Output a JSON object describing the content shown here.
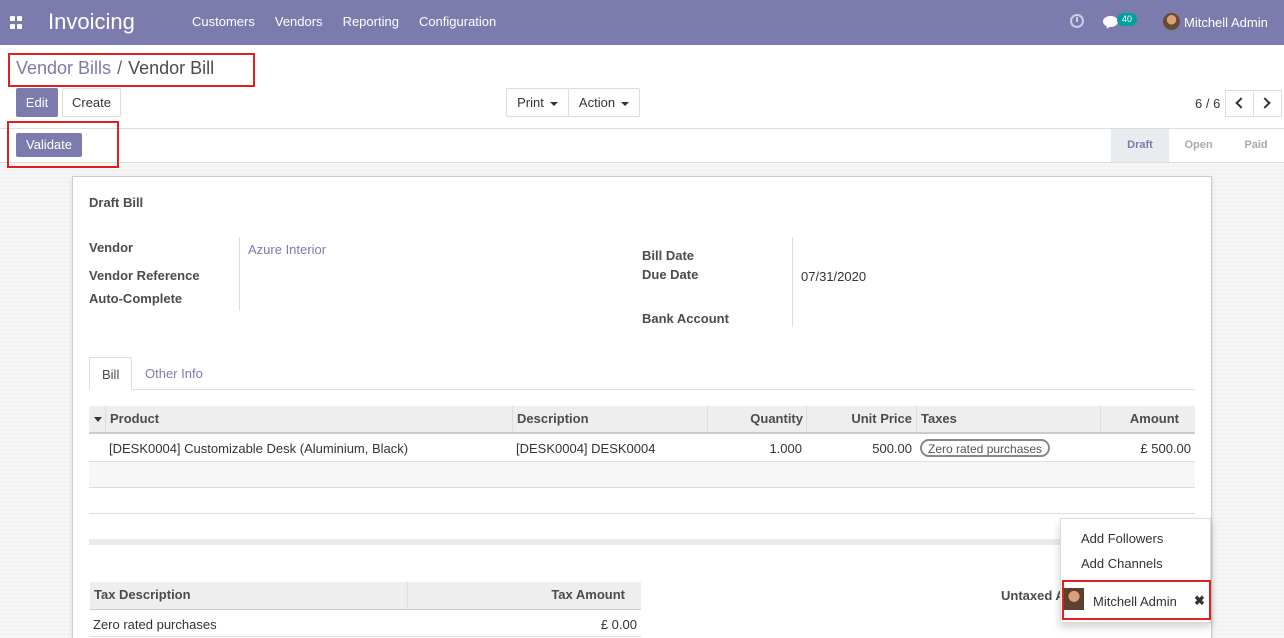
{
  "navbar": {
    "app_title": "Invoicing",
    "menu": [
      "Customers",
      "Vendors",
      "Reporting",
      "Configuration"
    ],
    "messages_count": "40",
    "user_name": "Mitchell Admin",
    "accent_color": "#7c7bad"
  },
  "breadcrumb": {
    "parent": "Vendor Bills",
    "separator": "/",
    "current": "Vendor Bill"
  },
  "buttons": {
    "edit": "Edit",
    "create": "Create",
    "print": "Print",
    "action": "Action",
    "validate": "Validate"
  },
  "pager": {
    "value": "6 / 6"
  },
  "statusbar": {
    "stages": [
      "Draft",
      "Open",
      "Paid"
    ],
    "active": "Draft"
  },
  "form": {
    "title": "Draft Bill",
    "vendor_label": "Vendor",
    "vendor_value": "Azure Interior",
    "vendor_reference_label": "Vendor Reference",
    "auto_complete_label": "Auto-Complete",
    "bill_date_label": "Bill Date",
    "due_date_label": "Due Date",
    "due_date_value": "07/31/2020",
    "bank_account_label": "Bank Account"
  },
  "tabs": [
    "Bill",
    "Other Info"
  ],
  "lines_table": {
    "headers": [
      "Product",
      "Description",
      "Quantity",
      "Unit Price",
      "Taxes",
      "Amount"
    ],
    "rows": [
      {
        "product": "[DESK0004] Customizable Desk (Aluminium, Black)",
        "description": "[DESK0004] DESK0004",
        "quantity": "1.000",
        "unit_price": "500.00",
        "taxes": "Zero rated purchases",
        "amount": "£ 500.00"
      }
    ]
  },
  "tax_table": {
    "headers": [
      "Tax Description",
      "Tax Amount"
    ],
    "rows": [
      {
        "description": "Zero rated purchases",
        "amount": "£ 0.00"
      }
    ]
  },
  "totals": {
    "untaxed_label": "Untaxed A"
  },
  "followers_dropdown": {
    "add_followers": "Add Followers",
    "add_channels": "Add Channels",
    "follower_name": "Mitchell Admin"
  }
}
